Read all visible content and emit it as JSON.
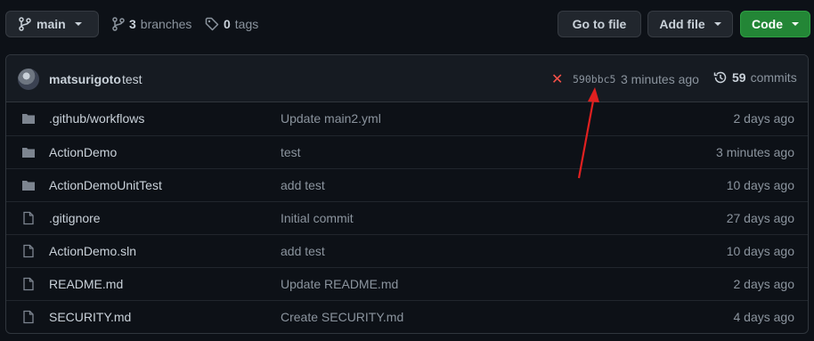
{
  "branch": {
    "name": "main"
  },
  "branches": {
    "count": "3",
    "label": "branches"
  },
  "tags": {
    "count": "0",
    "label": "tags"
  },
  "buttons": {
    "goto_file": "Go to file",
    "add_file": "Add file",
    "code": "Code"
  },
  "commit": {
    "author": "matsurigoto",
    "message": "test",
    "status": "failed",
    "sha": "590bbc5",
    "time": "3 minutes ago",
    "commits_count": "59",
    "commits_label": "commits"
  },
  "files": [
    {
      "type": "folder",
      "name": ".github/workflows",
      "message": "Update main2.yml",
      "age": "2 days ago"
    },
    {
      "type": "folder",
      "name": "ActionDemo",
      "message": "test",
      "age": "3 minutes ago"
    },
    {
      "type": "folder",
      "name": "ActionDemoUnitTest",
      "message": "add test",
      "age": "10 days ago"
    },
    {
      "type": "file",
      "name": ".gitignore",
      "message": "Initial commit",
      "age": "27 days ago"
    },
    {
      "type": "file",
      "name": "ActionDemo.sln",
      "message": "add test",
      "age": "10 days ago"
    },
    {
      "type": "file",
      "name": "README.md",
      "message": "Update README.md",
      "age": "2 days ago"
    },
    {
      "type": "file",
      "name": "SECURITY.md",
      "message": "Create SECURITY.md",
      "age": "4 days ago"
    }
  ],
  "colors": {
    "background": "#0d1117",
    "accent_green": "#238636",
    "error_red": "#f85149",
    "annotation_red": "#e02020"
  }
}
